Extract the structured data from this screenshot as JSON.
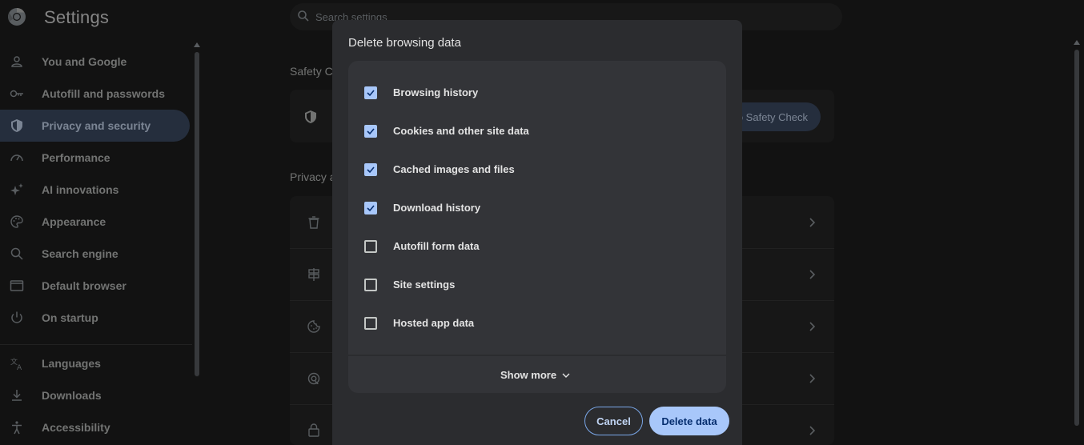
{
  "header": {
    "title": "Settings",
    "search_placeholder": "Search settings"
  },
  "sidebar": {
    "items": [
      {
        "label": "You and Google",
        "icon": "person-icon"
      },
      {
        "label": "Autofill and passwords",
        "icon": "key-icon"
      },
      {
        "label": "Privacy and security",
        "icon": "shield-icon",
        "active": true
      },
      {
        "label": "Performance",
        "icon": "gauge-icon"
      },
      {
        "label": "AI innovations",
        "icon": "sparkle-icon"
      },
      {
        "label": "Appearance",
        "icon": "palette-icon"
      },
      {
        "label": "Search engine",
        "icon": "search-icon"
      },
      {
        "label": "Default browser",
        "icon": "browser-icon"
      },
      {
        "label": "On startup",
        "icon": "power-icon"
      },
      {
        "label": "Languages",
        "icon": "translate-icon"
      },
      {
        "label": "Downloads",
        "icon": "download-icon"
      },
      {
        "label": "Accessibility",
        "icon": "accessibility-icon"
      }
    ]
  },
  "main": {
    "safety_heading": "Safety C",
    "safety_button": "o Safety Check",
    "privacy_heading": "Privacy a"
  },
  "dialog": {
    "title": "Delete browsing data",
    "options": [
      {
        "label": "Browsing history",
        "checked": true
      },
      {
        "label": "Cookies and other site data",
        "checked": true
      },
      {
        "label": "Cached images and files",
        "checked": true
      },
      {
        "label": "Download history",
        "checked": true
      },
      {
        "label": "Autofill form data",
        "checked": false
      },
      {
        "label": "Site settings",
        "checked": false
      },
      {
        "label": "Hosted app data",
        "checked": false
      }
    ],
    "show_more": "Show more",
    "cancel": "Cancel",
    "delete": "Delete data"
  },
  "colors": {
    "accent": "#a8c7fa",
    "active_nav": "#41506a",
    "dialog_bg": "#2b2c2f"
  }
}
